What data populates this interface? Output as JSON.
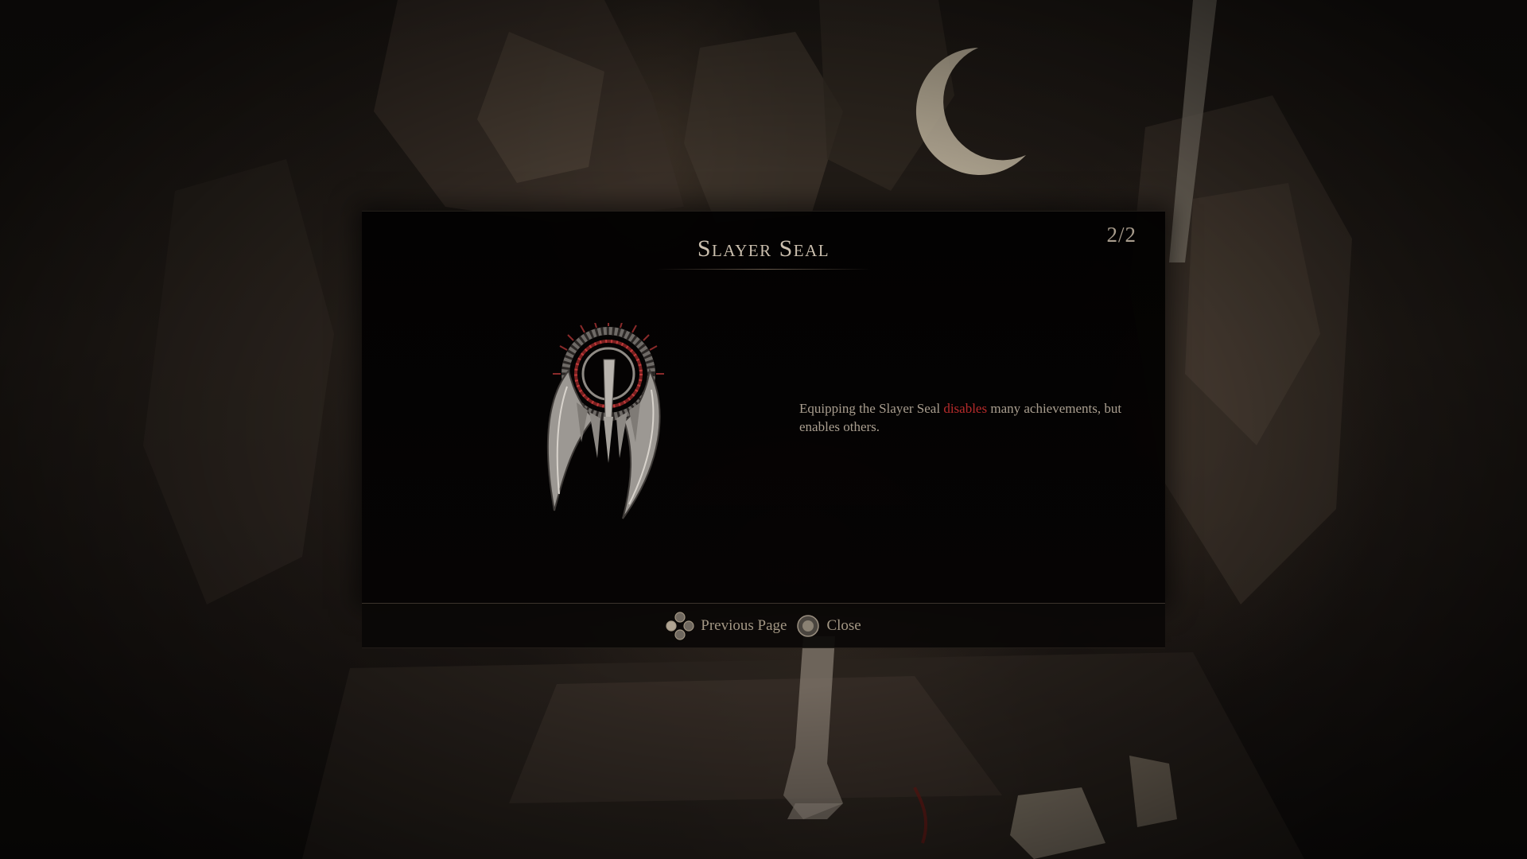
{
  "dialog": {
    "title": "Slayer Seal",
    "page_indicator": "2/2",
    "item_icon": "slayer-seal-icon",
    "description": {
      "before": "Equipping the Slayer Seal ",
      "highlight": "disables",
      "after": " many achievements, but enables others."
    },
    "highlight_color": "#b52b2b"
  },
  "footer": {
    "prompts": [
      {
        "icon": "dpad-icon",
        "label": "Previous Page"
      },
      {
        "icon": "circle-button-icon",
        "label": "Close"
      }
    ]
  }
}
